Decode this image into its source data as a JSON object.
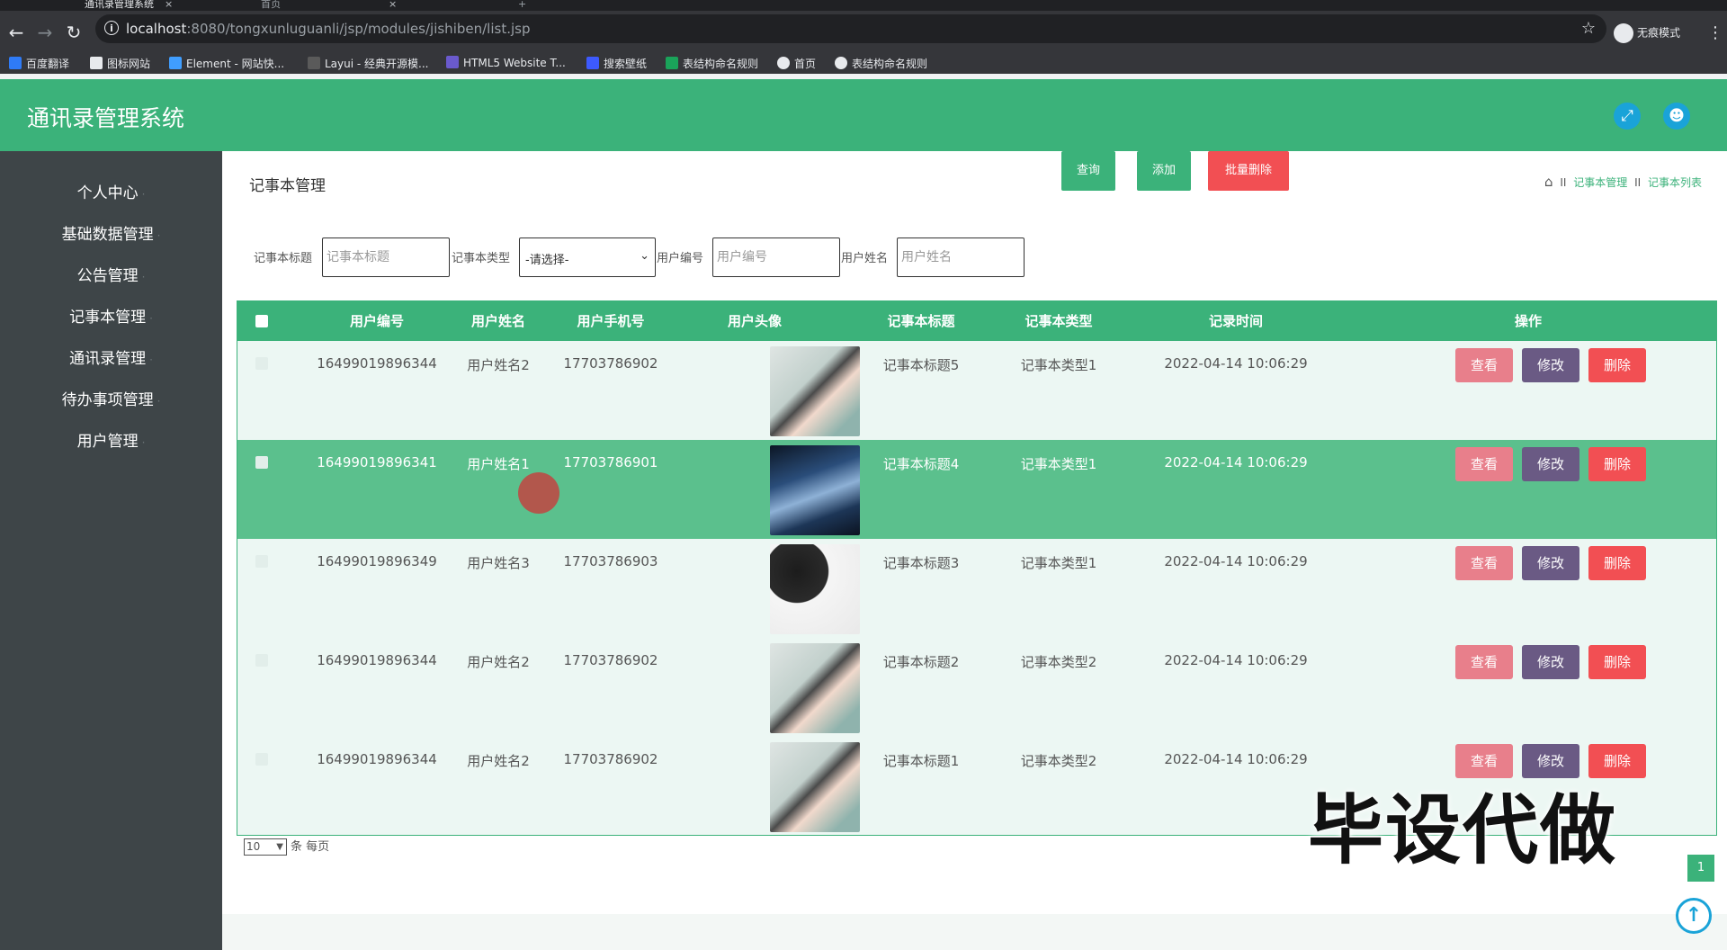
{
  "browser": {
    "tabs": [
      {
        "label": "通讯录管理系统",
        "close": "×"
      },
      {
        "label": "首页",
        "close": "×"
      }
    ],
    "new_tab": "+",
    "url_host": "localhost",
    "url_path": ":8080/tongxunluguanli/jsp/modules/jishiben/list.jsp",
    "profile_label": "无痕模式",
    "bookmarks": [
      "百度翻译",
      "图标网站",
      "Element - 网站快...",
      "Layui - 经典开源模...",
      "HTML5 Website T...",
      "搜索壁纸",
      "表结构命名规则",
      "首页",
      "表结构命名规则"
    ]
  },
  "app": {
    "title": "通讯录管理系统",
    "colors": {
      "primary": "#3bb27a",
      "sidebar": "#3e4548",
      "view": "#e87f8b",
      "edit": "#6a5a84",
      "delete": "#f24f53"
    }
  },
  "sidebar": {
    "items": [
      {
        "label": "个人中心"
      },
      {
        "label": "基础数据管理"
      },
      {
        "label": "公告管理"
      },
      {
        "label": "记事本管理"
      },
      {
        "label": "通讯录管理"
      },
      {
        "label": "待办事项管理"
      },
      {
        "label": "用户管理"
      }
    ]
  },
  "page": {
    "title": "记事本管理",
    "breadcrumb": {
      "sep": "II",
      "level1": "记事本管理",
      "level2": "记事本列表"
    }
  },
  "filters": {
    "title_label": "记事本标题",
    "title_placeholder": "记事本标题",
    "type_label": "记事本类型",
    "type_selected": "-请选择-",
    "userno_label": "用户编号",
    "userno_placeholder": "用户编号",
    "username_label": "用户姓名",
    "username_placeholder": "用户姓名",
    "search_btn": "查询",
    "add_btn": "添加",
    "batch_delete_btn": "批量删除"
  },
  "table": {
    "columns": [
      "用户编号",
      "用户姓名",
      "用户手机号",
      "用户头像",
      "记事本标题",
      "记事本类型",
      "记录时间",
      "操作"
    ],
    "rows": [
      {
        "user_no": "16499019896344",
        "user_name": "用户姓名2",
        "phone": "17703786902",
        "title": "记事本标题5",
        "type": "记事本类型1",
        "time": "2022-04-14 10:06:29"
      },
      {
        "user_no": "16499019896341",
        "user_name": "用户姓名1",
        "phone": "17703786901",
        "title": "记事本标题4",
        "type": "记事本类型1",
        "time": "2022-04-14 10:06:29"
      },
      {
        "user_no": "16499019896349",
        "user_name": "用户姓名3",
        "phone": "17703786903",
        "title": "记事本标题3",
        "type": "记事本类型1",
        "time": "2022-04-14 10:06:29"
      },
      {
        "user_no": "16499019896344",
        "user_name": "用户姓名2",
        "phone": "17703786902",
        "title": "记事本标题2",
        "type": "记事本类型2",
        "time": "2022-04-14 10:06:29"
      },
      {
        "user_no": "16499019896344",
        "user_name": "用户姓名2",
        "phone": "17703786902",
        "title": "记事本标题1",
        "type": "记事本类型2",
        "time": "2022-04-14 10:06:29"
      }
    ],
    "actions": {
      "view": "查看",
      "edit": "修改",
      "delete": "删除"
    }
  },
  "pagination": {
    "page_size": "10",
    "page_size_suffix": "条 每页",
    "current_page": "1"
  },
  "overlay": {
    "watermark": "毕设代做"
  }
}
